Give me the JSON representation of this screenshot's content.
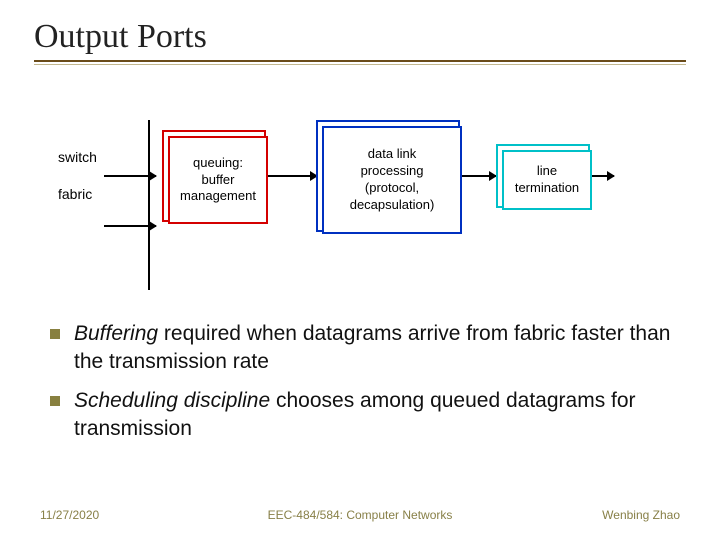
{
  "title": "Output Ports",
  "diagram": {
    "switch_label_1": "switch",
    "switch_label_2": "fabric",
    "box1": "queuing:\nbuffer\nmanagement",
    "box2": "data link\nprocessing\n(protocol,\ndecapsulation)",
    "box3": "line\ntermination"
  },
  "bullets": [
    {
      "em": "Buffering",
      "rest": " required when datagrams arrive from fabric faster than the transmission rate"
    },
    {
      "em": "Scheduling discipline",
      "rest": " chooses among queued datagrams for transmission"
    }
  ],
  "footer": {
    "date": "11/27/2020",
    "course": "EEC-484/584: Computer Networks",
    "author": "Wenbing Zhao"
  }
}
